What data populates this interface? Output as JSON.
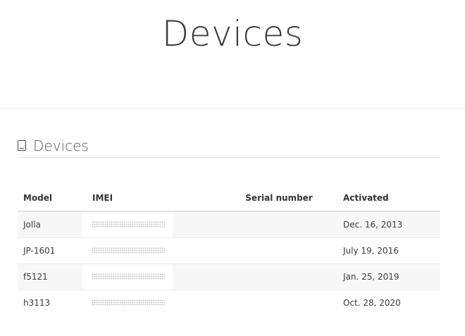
{
  "page": {
    "title": "Devices"
  },
  "section": {
    "icon": "tablet-icon",
    "title": "Devices"
  },
  "table": {
    "headers": {
      "model": "Model",
      "imei": "IMEI",
      "serial": "Serial number",
      "activated": "Activated"
    },
    "rows": [
      {
        "model": "Jolla",
        "imei": "",
        "serial": "",
        "activated": "Dec. 16, 2013"
      },
      {
        "model": "JP-1601",
        "imei": "",
        "serial": "",
        "activated": "July 19, 2016"
      },
      {
        "model": "f5121",
        "imei": "",
        "serial": "",
        "activated": "Jan. 25, 2019"
      },
      {
        "model": "h3113",
        "imei": "",
        "serial": "",
        "activated": "Oct. 28, 2020"
      }
    ]
  }
}
